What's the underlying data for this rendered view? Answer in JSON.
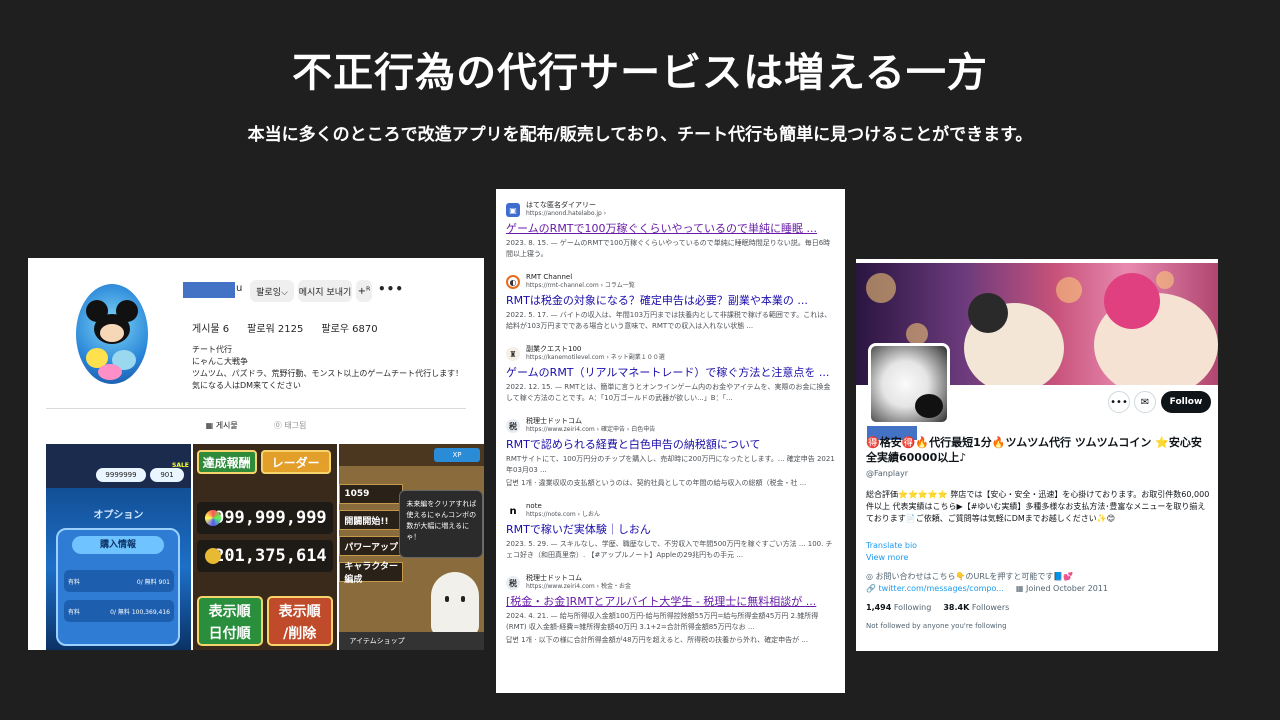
{
  "slide": {
    "title": "不正行為の代行サービスは増える一方",
    "subtitle": "本当に多くのところで改造アプリを配布/販売しており、チート代行も簡単に見つけることができます。"
  },
  "instagram": {
    "name_tail": "u",
    "follow_button": "팔로잉⌵",
    "message_button": "메시지 보내기",
    "add_user_icon": "+ᴿ",
    "more_icon": "•••",
    "stats": {
      "posts": "게시물 6",
      "followers": "팔로워 2125",
      "following": "팔로우 6870"
    },
    "bio_lines": [
      "チート代行",
      "にゃんこ大戦争",
      "ツムツム、パズドラ、荒野行動、モンスト以上のゲームチート代行します！",
      "気になる人はDM来てください"
    ],
    "tabs": {
      "posts": "▦ 게시물",
      "tagged": "⓪ 태그됨"
    },
    "tile1": {
      "coins": "9999999",
      "level": "901",
      "sale": "SALE",
      "options": "オプション",
      "purchase_info": "購入情報",
      "row1_label": "有料",
      "row1_value": "0/ 無料 901",
      "row2_label": "有料",
      "row2_value": "0/ 無料 100,369,416"
    },
    "tile2": {
      "badge1": "達成報酬",
      "badge2": "レーダー",
      "value1": "999,999,999",
      "value2": "201,375,614",
      "sort1_line1": "表示順",
      "sort1_line2": "日付順",
      "sort2_line1": "表示順",
      "sort2_line2": "/削除"
    },
    "tile3": {
      "xp": "XP",
      "menu1": "1059",
      "menu2": "開闢開始!!",
      "menu3": "パワーアップ",
      "menu4": "キャラクター編成",
      "popup": "未来編をクリアすれば使えるにゃんコンボの数が大幅に増えるにゃ！",
      "bottom": "アイテムショップ"
    }
  },
  "search": {
    "results": [
      {
        "site": "はてな匿名ダイアリー",
        "url": "https://anond.hatelabo.jp ›",
        "title": "ゲームのRMTで100万稼ぐくらいやっているので単純に睡眠 ...",
        "snippet": "2023. 8. 15. — ゲームのRMTで100万稼ぐくらいやっているので単純に睡眠時間足りない説。毎日6時間以上寝う。",
        "fav": "▣"
      },
      {
        "site": "RMT Channel",
        "url": "https://rmt-channel.com › コラム一覧",
        "title": "RMTは税金の対象になる？確定申告は必要？副業や本業の ...",
        "snippet": "2022. 5. 17. — バイトの収入は、年間103万円までは扶養内として非課税で稼げる範囲です。これは、給料が103万円までである場合という意味で、RMTでの収入は入れない状態 ...",
        "fav": "◐"
      },
      {
        "site": "副業クエスト100",
        "url": "https://kanemotilevel.com › ネット副業１００選",
        "title": "ゲームのRMT（リアルマネートレード）で稼ぐ方法と注意点を ...",
        "snippet": "2022. 12. 15. — RMTとは、簡単に言うとオンラインゲーム内のお金やアイテムを、実際のお金に換金して稼ぐ方法のことです。A：「10万ゴールドの武器が欲しい...」B：「...",
        "fav": "♜"
      },
      {
        "site": "税理士ドットコム",
        "url": "https://www.zeiri4.com › 確定申告 › 白色申告",
        "title": "RMTで認められる経費と白色申告の納税額について",
        "snippet": "RMTサイトにて、100万円分のチップを購入し、売却時に200万円になったとします。... 確定申告 2021年03月03 ...",
        "snippet2": "답변 1개 · 違業収収の支払額というのは、契約社員としての年間の給与収入の総額（税金・社 ...",
        "fav": "税"
      },
      {
        "site": "note",
        "url": "https://note.com › しおん",
        "title": "RMTで稼いだ実体験｜しおん",
        "snippet": "2023. 5. 29. — スキルなし、学歴、職歴なしで、不労収入で年間500万円を稼ぐすごい方法 ... 100. チェコ好き（和田真里奈）. 【#アップルノート】Appleの29兆円もの手元 ...",
        "fav": "n"
      },
      {
        "site": "税理士ドットコム",
        "url": "https://www.zeiri4.com › 税金・お金",
        "title": "[税金・お金]RMTとアルバイト大学生 - 税理士に無料相談が ...",
        "snippet": "2024. 4. 21. — 給与所得収入金額100万円-給与所得控除額55万円=給与所得金額45万円 2.雑所得(RMT) 収入金額-経費=雑所得金額40万円 3.1+2=合計所得金額85万円なお ...",
        "snippet2": "답변 1개 · 以下の様に合計所得金額が48万円を超えると、所得税の扶養から外れ、確定申告が ...",
        "fav": "税"
      }
    ]
  },
  "twitter": {
    "more_icon": "•••",
    "mail_icon": "✉",
    "follow_button": "Follow",
    "name": "🉐格安🉐🔥代行最短1分🔥ツムツム代行 ツムツムコイン ⭐安心安全実績60000以上♪",
    "handle": "@Fanplayr",
    "bio": "総合評価⭐⭐⭐⭐⭐ 弊店では【安心・安全・迅速】を心掛けております。お取引件数60,000件以上 代表実績はこちら▶【#ゆいむ実績】多種多様なお支払方法･豊富なメニューを取り揃えております📄ご依頼、ご質問等は気軽にDMまでお越しください✨😊",
    "translate": "Translate bio",
    "view_more": "View more",
    "contact": "お問い合わせはこちら👇のURLを押すと可能です📘💕",
    "link": "twitter.com/messages/compo...",
    "joined": "Joined October 2011",
    "following_count": "1,494",
    "following_label": "Following",
    "followers_count": "38.4K",
    "followers_label": "Followers",
    "not_followed": "Not followed by anyone you're following"
  }
}
